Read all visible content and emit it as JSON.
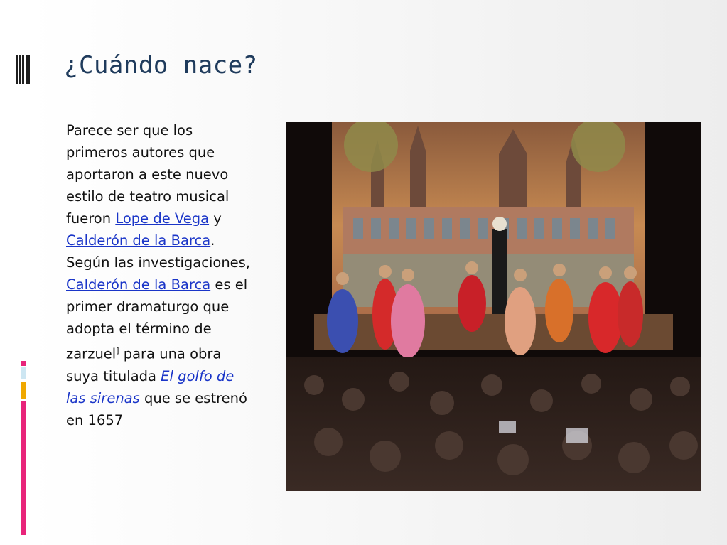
{
  "slide": {
    "title": "¿Cuándo  nace?",
    "body": {
      "t1": "Parece ser que los primeros autores que aportaron a este nuevo estilo de teatro musical fueron ",
      "link_lope": "Lope de Vega",
      "t2": " y ",
      "link_calderon1": "Calderón de la Barca",
      "t3": ". Según las investigaciones, ",
      "link_calderon2": "Calderón de la Barca",
      "t4": " es el primer dramaturgo que adopta el término de zarzuel",
      "sup": "]",
      "t5": " para una obra suya titulada ",
      "link_golfo": "El golfo de las sirenas",
      "t6": " que se estrenó en 1657"
    }
  },
  "colors": {
    "title": "#1f3b5c",
    "link": "#1a35c8",
    "accent_magenta": "#e8247a",
    "accent_lightblue": "#cde6f2",
    "accent_orange": "#f0a800"
  }
}
